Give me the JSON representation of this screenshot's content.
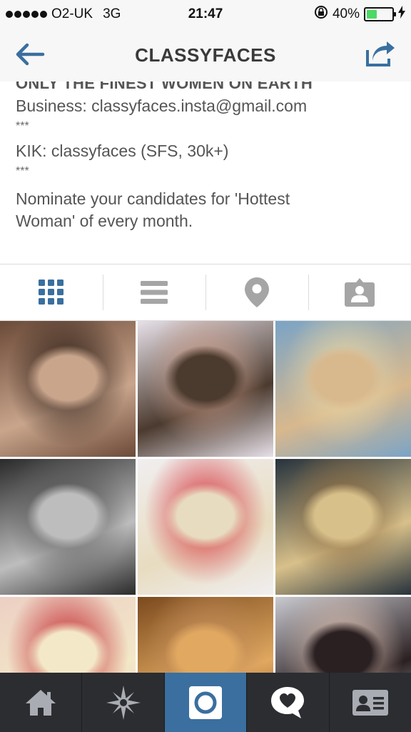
{
  "status_bar": {
    "carrier": "O2-UK",
    "network": "3G",
    "time": "21:47",
    "battery_percent": "40%",
    "battery_level": 0.4,
    "battery_color": "#4cd964"
  },
  "nav": {
    "title": "CLASSYFACES",
    "accent_color": "#3a6f9f",
    "back_icon": "back-arrow-icon",
    "share_icon": "share-icon"
  },
  "bio": {
    "cut_line": "ONLY THE FINEST WOMEN ON EARTH",
    "business": "Business: classyfaces.insta@gmail.com",
    "separator_1": "***",
    "kik": "KIK: classyfaces (SFS, 30k+)",
    "separator_2": "***",
    "nominate_1": "Nominate your candidates for 'Hottest",
    "nominate_2": "Woman' of every month."
  },
  "profile_tabs": [
    {
      "name": "grid-view",
      "icon": "grid-icon",
      "active": true
    },
    {
      "name": "list-view",
      "icon": "list-icon",
      "active": false
    },
    {
      "name": "map-view",
      "icon": "location-pin-icon",
      "active": false
    },
    {
      "name": "tagged-photos",
      "icon": "person-tag-icon",
      "active": false
    }
  ],
  "photos": [
    {
      "subject": "brunette portrait",
      "palette": [
        "#6b4a38",
        "#c9a58c",
        "#2a1c15"
      ]
    },
    {
      "subject": "brunette long hair",
      "palette": [
        "#e6e0e8",
        "#4b3a2e",
        "#c79a86"
      ]
    },
    {
      "subject": "blonde on beach",
      "palette": [
        "#7aa4c6",
        "#d8b88d",
        "#e9d7a6"
      ]
    },
    {
      "subject": "black and white portrait",
      "palette": [
        "#2a2a2a",
        "#bdbdbd",
        "#5a5a5a"
      ]
    },
    {
      "subject": "platinum blonde red lips",
      "palette": [
        "#f0eef0",
        "#e8dcc0",
        "#d52e3a"
      ]
    },
    {
      "subject": "blonde with fur jacket",
      "palette": [
        "#26323c",
        "#d8c08a",
        "#8a6a40"
      ]
    },
    {
      "subject": "blonde red lips close-up",
      "palette": [
        "#ecd0c4",
        "#f3e8c8",
        "#c01c26"
      ]
    },
    {
      "subject": "blonde warm tones",
      "palette": [
        "#7b4a1e",
        "#e0a860",
        "#c58e5c"
      ]
    },
    {
      "subject": "dark hair close-up",
      "palette": [
        "#c9c9cf",
        "#2a2022",
        "#d6b8a8"
      ]
    }
  ],
  "bottom_tabs": [
    {
      "name": "home",
      "icon": "home-icon",
      "active": false
    },
    {
      "name": "explore",
      "icon": "explore-star-icon",
      "active": false
    },
    {
      "name": "camera",
      "icon": "camera-icon",
      "active": true
    },
    {
      "name": "activity",
      "icon": "heart-bubble-icon",
      "active": false
    },
    {
      "name": "profile",
      "icon": "profile-card-icon",
      "active": false
    }
  ]
}
